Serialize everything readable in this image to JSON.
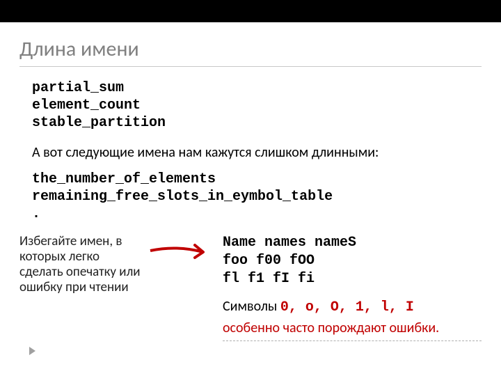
{
  "title": "Длина имени",
  "good_names": [
    "partial_sum",
    "element_count",
    "stable_partition"
  ],
  "intro": "А вот следующие имена нам кажутся слишком длинными:",
  "long_names": [
    "the_number_of_elements",
    "remaining_free_slots_in_eymbol_table",
    "."
  ],
  "note": "Избегайте имен, в которых легко сделать опечатку или ошибку при чтении",
  "tricky": [
    "Name names nameS",
    "foo f00 fOO",
    "fl f1 fI fi"
  ],
  "sym_prefix": "Символы",
  "symbols": "0, o, O, 1, l, I",
  "warn": "особенно часто порождают ошибки.",
  "colors": {
    "accent": "#c00000",
    "title": "#808080"
  }
}
